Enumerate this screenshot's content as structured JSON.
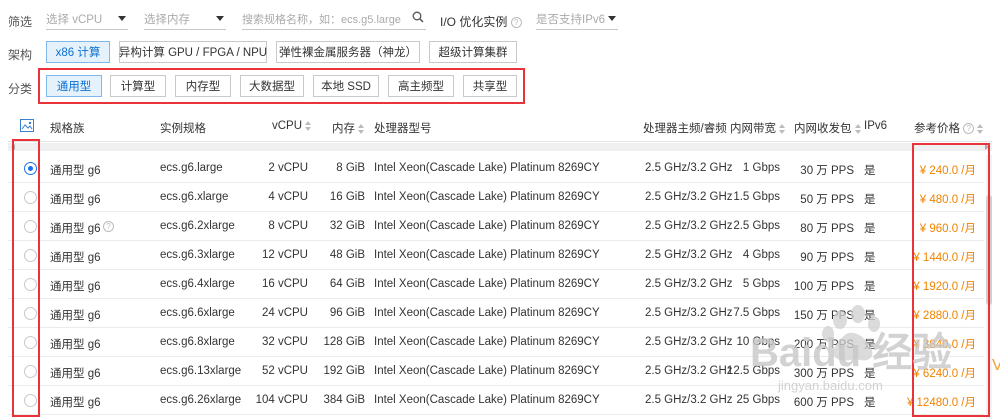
{
  "filter": {
    "label": "筛选",
    "vcpu_placeholder": "选择 vCPU",
    "memory_placeholder": "选择内存",
    "search_placeholder": "搜索规格名称，如：ecs.g5.large",
    "io_label": "I/O 优化实例",
    "ipv6_placeholder": "是否支持IPv6"
  },
  "arch": {
    "label": "架构",
    "options": [
      "x86 计算",
      "异构计算 GPU / FPGA / NPU",
      "弹性裸金属服务器（神龙）",
      "超级计算集群"
    ],
    "selected": "x86 计算"
  },
  "category": {
    "label": "分类",
    "options": [
      "通用型",
      "计算型",
      "内存型",
      "大数据型",
      "本地 SSD",
      "高主频型",
      "共享型"
    ],
    "selected": "通用型"
  },
  "table": {
    "headers": {
      "family": "规格族",
      "spec": "实例规格",
      "vcpu": "vCPU",
      "memory": "内存",
      "cpu_model": "处理器型号",
      "freq": "处理器主频/睿频",
      "bandwidth": "内网带宽",
      "pps": "内网收发包",
      "ipv6": "IPv6",
      "price": "参考价格"
    },
    "rows": [
      {
        "family": "通用型 g6",
        "spec": "ecs.g6.large",
        "vcpu": "2 vCPU",
        "memory": "8 GiB",
        "cpu_model": "Intel Xeon(Cascade Lake) Platinum 8269CY",
        "freq": "2.5 GHz/3.2 GHz",
        "bandwidth": "1 Gbps",
        "pps": "30 万 PPS",
        "ipv6": "是",
        "price": "¥ 240.0 /月",
        "selected": true
      },
      {
        "family": "通用型 g6",
        "spec": "ecs.g6.xlarge",
        "vcpu": "4 vCPU",
        "memory": "16 GiB",
        "cpu_model": "Intel Xeon(Cascade Lake) Platinum 8269CY",
        "freq": "2.5 GHz/3.2 GHz",
        "bandwidth": "1.5 Gbps",
        "pps": "50 万 PPS",
        "ipv6": "是",
        "price": "¥ 480.0 /月"
      },
      {
        "family": "通用型 g6",
        "spec": "ecs.g6.2xlarge",
        "vcpu": "8 vCPU",
        "memory": "32 GiB",
        "cpu_model": "Intel Xeon(Cascade Lake) Platinum 8269CY",
        "freq": "2.5 GHz/3.2 GHz",
        "bandwidth": "2.5 Gbps",
        "pps": "80 万 PPS",
        "ipv6": "是",
        "price": "¥ 960.0 /月",
        "help": true
      },
      {
        "family": "通用型 g6",
        "spec": "ecs.g6.3xlarge",
        "vcpu": "12 vCPU",
        "memory": "48 GiB",
        "cpu_model": "Intel Xeon(Cascade Lake) Platinum 8269CY",
        "freq": "2.5 GHz/3.2 GHz",
        "bandwidth": "4 Gbps",
        "pps": "90 万 PPS",
        "ipv6": "是",
        "price": "¥ 1440.0 /月"
      },
      {
        "family": "通用型 g6",
        "spec": "ecs.g6.4xlarge",
        "vcpu": "16 vCPU",
        "memory": "64 GiB",
        "cpu_model": "Intel Xeon(Cascade Lake) Platinum 8269CY",
        "freq": "2.5 GHz/3.2 GHz",
        "bandwidth": "5 Gbps",
        "pps": "100 万 PPS",
        "ipv6": "是",
        "price": "¥ 1920.0 /月"
      },
      {
        "family": "通用型 g6",
        "spec": "ecs.g6.6xlarge",
        "vcpu": "24 vCPU",
        "memory": "96 GiB",
        "cpu_model": "Intel Xeon(Cascade Lake) Platinum 8269CY",
        "freq": "2.5 GHz/3.2 GHz",
        "bandwidth": "7.5 Gbps",
        "pps": "150 万 PPS",
        "ipv6": "是",
        "price": "¥ 2880.0 /月"
      },
      {
        "family": "通用型 g6",
        "spec": "ecs.g6.8xlarge",
        "vcpu": "32 vCPU",
        "memory": "128 GiB",
        "cpu_model": "Intel Xeon(Cascade Lake) Platinum 8269CY",
        "freq": "2.5 GHz/3.2 GHz",
        "bandwidth": "10 Gbps",
        "pps": "200 万 PPS",
        "ipv6": "是",
        "price": "¥ 3840.0 /月"
      },
      {
        "family": "通用型 g6",
        "spec": "ecs.g6.13xlarge",
        "vcpu": "52 vCPU",
        "memory": "192 GiB",
        "cpu_model": "Intel Xeon(Cascade Lake) Platinum 8269CY",
        "freq": "2.5 GHz/3.2 GHz",
        "bandwidth": "12.5 Gbps",
        "pps": "300 万 PPS",
        "ipv6": "是",
        "price": "¥ 6240.0 /月"
      },
      {
        "family": "通用型 g6",
        "spec": "ecs.g6.26xlarge",
        "vcpu": "104 vCPU",
        "memory": "384 GiB",
        "cpu_model": "Intel Xeon(Cascade Lake) Platinum 8269CY",
        "freq": "2.5 GHz/3.2 GHz",
        "bandwidth": "25 Gbps",
        "pps": "600 万 PPS",
        "ipv6": "是",
        "price": "¥ 12480.0 /月"
      }
    ]
  },
  "watermark": {
    "text": "Baidu 经验",
    "sub": "jingyan.baidu.com"
  },
  "colors": {
    "accent": "#0a70d6",
    "price": "#f08300",
    "highlight_box": "#e8333a",
    "selected_bg": "#e6f2fb"
  }
}
